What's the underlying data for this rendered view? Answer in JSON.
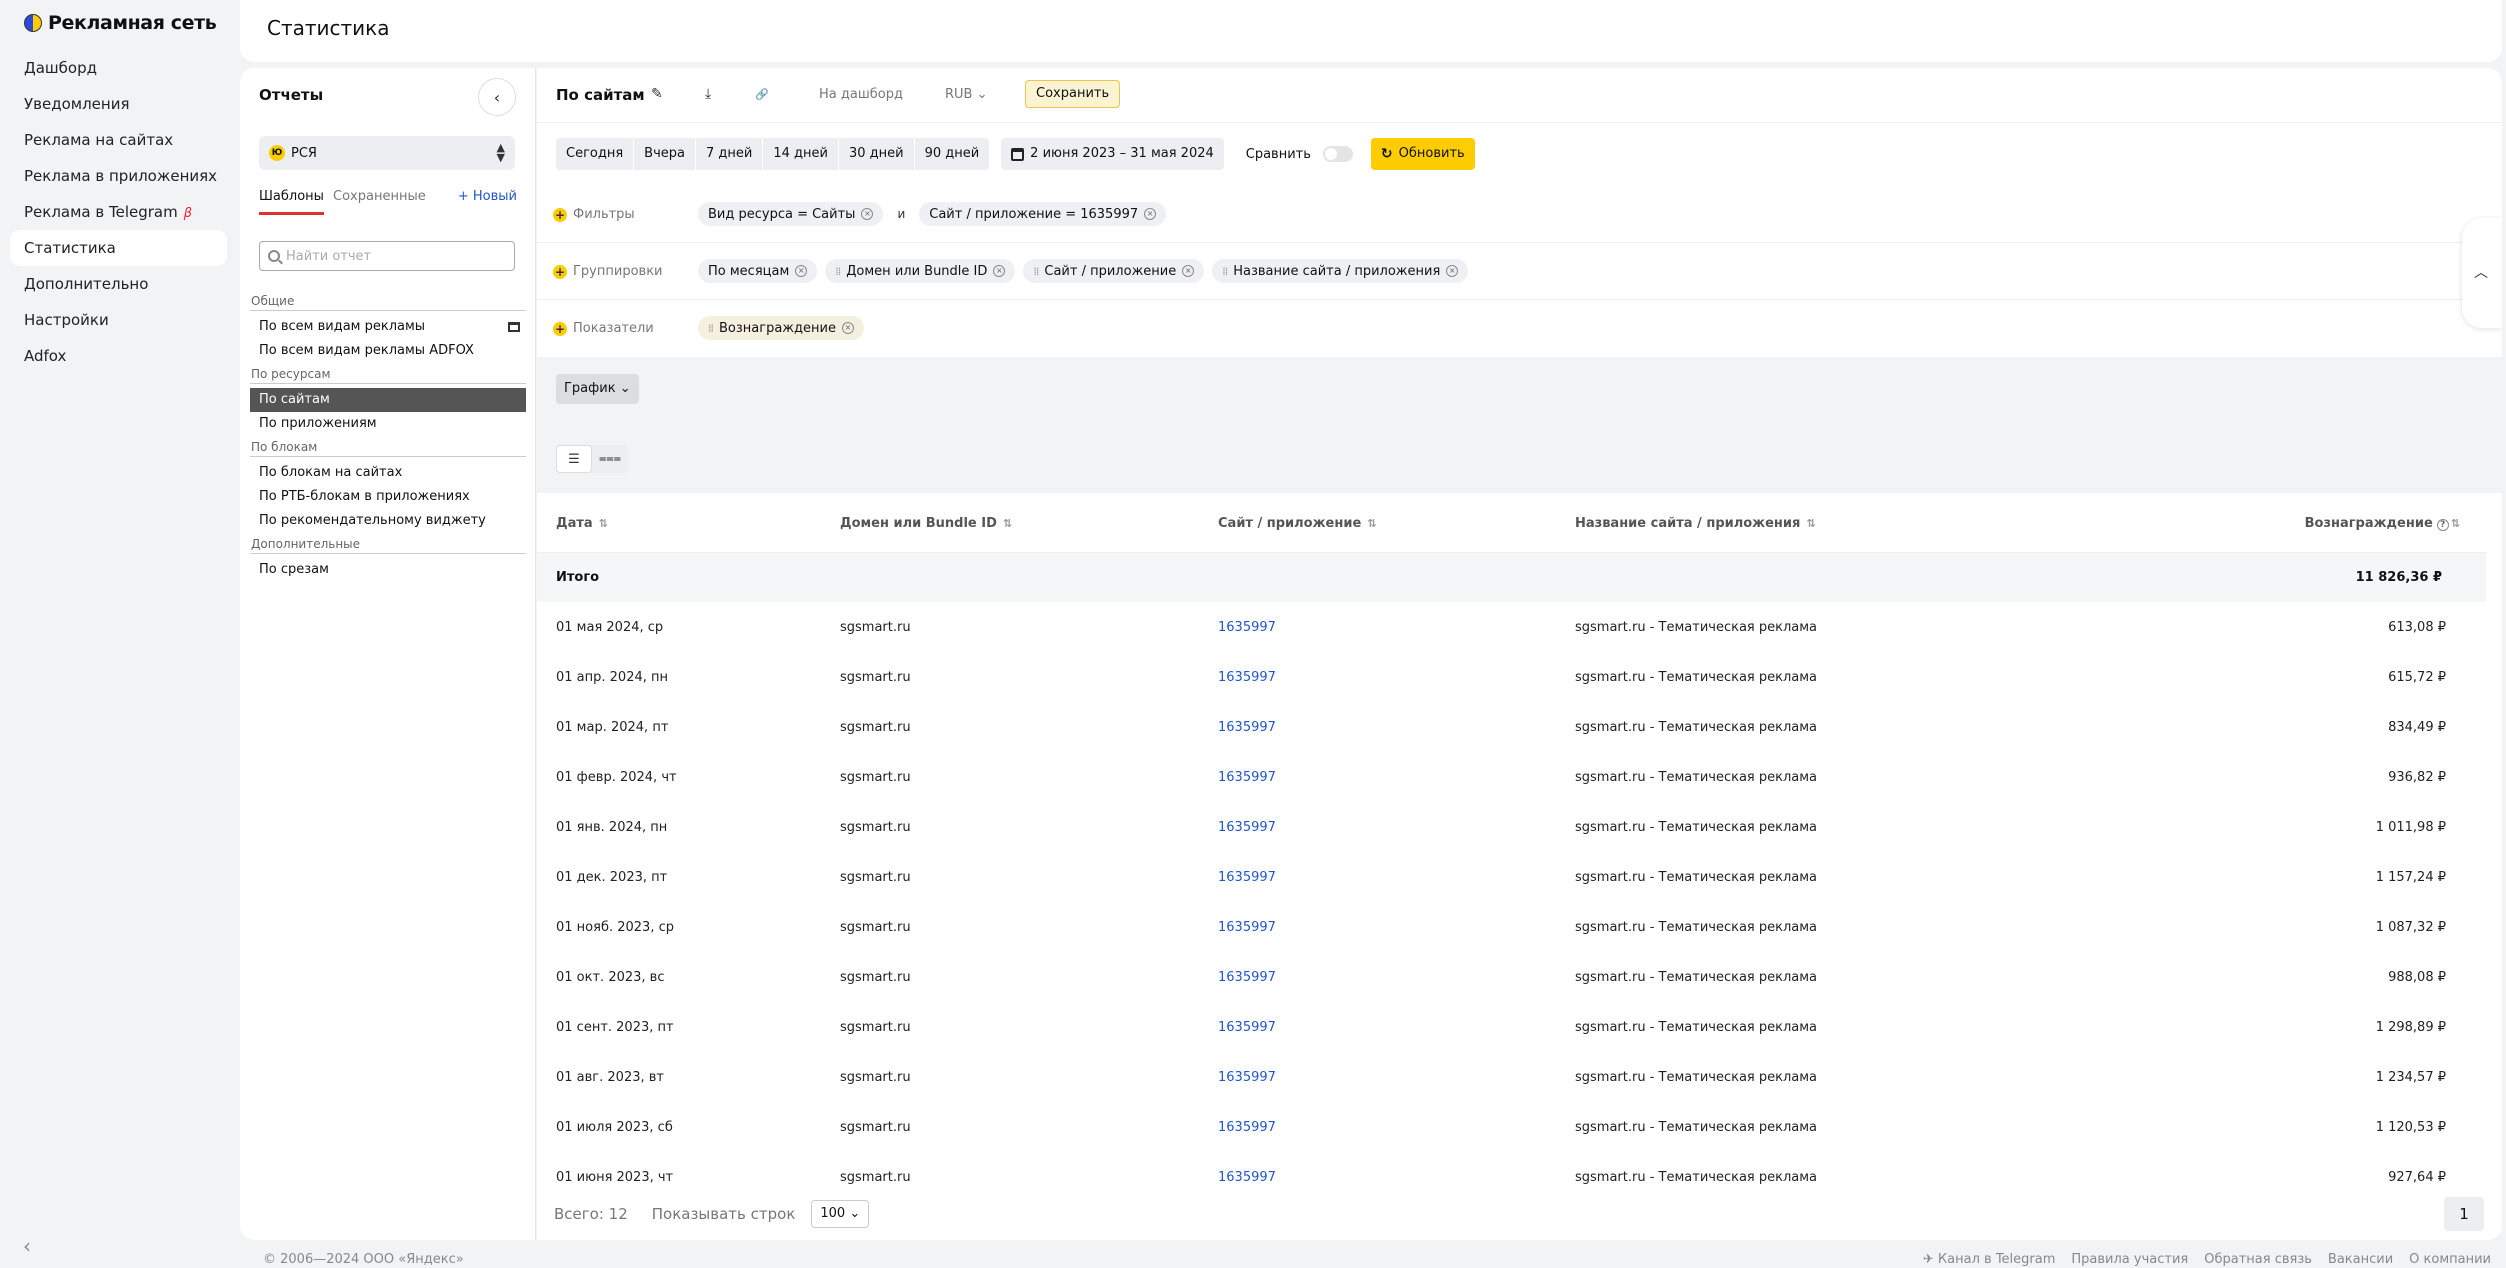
{
  "brand": {
    "name": "Рекламная сеть"
  },
  "nav": {
    "items": [
      {
        "label": "Дашборд"
      },
      {
        "label": "Уведомления"
      },
      {
        "label": "Реклама на сайтах"
      },
      {
        "label": "Реклама в приложениях"
      },
      {
        "label": "Реклама в Telegram",
        "badge": "β"
      },
      {
        "label": "Статистика",
        "active": true
      },
      {
        "label": "Дополнительно"
      },
      {
        "label": "Настройки"
      },
      {
        "label": "Adfox"
      }
    ],
    "collapse_icon": "‹"
  },
  "header": {
    "title": "Статистика"
  },
  "reports": {
    "title": "Отчеты",
    "collapse_icon": "‹",
    "account": {
      "coin": "Ю",
      "label": "РСЯ"
    },
    "tabs": [
      {
        "label": "Шаблоны",
        "active": true
      },
      {
        "label": "Сохраненные"
      }
    ],
    "new_label": "+ Новый",
    "search_placeholder": "Найти отчет",
    "groups": [
      {
        "title": "Общие",
        "items": [
          {
            "label": "По всем видам рекламы",
            "has_dashboard_icon": true
          },
          {
            "label": "По всем видам рекламы ADFOX"
          }
        ]
      },
      {
        "title": "По ресурсам",
        "items": [
          {
            "label": "По сайтам",
            "active": true
          },
          {
            "label": "По приложениям"
          }
        ]
      },
      {
        "title": "По блокам",
        "items": [
          {
            "label": "По блокам на сайтах"
          },
          {
            "label": "По РТБ-блокам в приложениях"
          },
          {
            "label": "По рекомендательному виджету"
          }
        ]
      },
      {
        "title": "Дополнительные",
        "items": [
          {
            "label": "По срезам"
          }
        ]
      }
    ]
  },
  "toolbar": {
    "title": "По сайтам",
    "edit_icon": "✎",
    "download_icon": "⤓",
    "link_icon": "🔗",
    "dashboard_label": "На дашборд",
    "currency": "RUB",
    "save_label": "Сохранить"
  },
  "period": {
    "presets": [
      "Сегодня",
      "Вчера",
      "7 дней",
      "14 дней",
      "30 дней",
      "90 дней"
    ],
    "range": "2 июня 2023 – 31 мая 2024",
    "compare_label": "Сравнить",
    "refresh_label": "Обновить"
  },
  "filters": {
    "label": "Фильтры",
    "chips": [
      "Вид ресурса = Сайты",
      "Сайт / приложение = 1635997"
    ],
    "connector": "и"
  },
  "groupings": {
    "label": "Группировки",
    "chips": [
      "По месяцам",
      "Домен или Bundle ID",
      "Сайт / приложение",
      "Название сайта / приложения"
    ]
  },
  "metrics": {
    "label": "Показатели",
    "chips": [
      "Вознаграждение"
    ]
  },
  "chart_button": "График",
  "table": {
    "columns": [
      "Дата",
      "Домен или Bundle ID",
      "Сайт / приложение",
      "Название сайта / приложения",
      "Вознаграждение"
    ],
    "total": {
      "label": "Итого",
      "value": "11 826,36 ₽"
    },
    "rows": [
      {
        "date": "01 мая 2024, ср",
        "domain": "sgsmart.ru",
        "site": "1635997",
        "name": "sgsmart.ru - Тематическая реклама",
        "reward": "613,08 ₽"
      },
      {
        "date": "01 апр. 2024, пн",
        "domain": "sgsmart.ru",
        "site": "1635997",
        "name": "sgsmart.ru - Тематическая реклама",
        "reward": "615,72 ₽"
      },
      {
        "date": "01 мар. 2024, пт",
        "domain": "sgsmart.ru",
        "site": "1635997",
        "name": "sgsmart.ru - Тематическая реклама",
        "reward": "834,49 ₽"
      },
      {
        "date": "01 февр. 2024, чт",
        "domain": "sgsmart.ru",
        "site": "1635997",
        "name": "sgsmart.ru - Тематическая реклама",
        "reward": "936,82 ₽"
      },
      {
        "date": "01 янв. 2024, пн",
        "domain": "sgsmart.ru",
        "site": "1635997",
        "name": "sgsmart.ru - Тематическая реклама",
        "reward": "1 011,98 ₽"
      },
      {
        "date": "01 дек. 2023, пт",
        "domain": "sgsmart.ru",
        "site": "1635997",
        "name": "sgsmart.ru - Тематическая реклама",
        "reward": "1 157,24 ₽"
      },
      {
        "date": "01 нояб. 2023, ср",
        "domain": "sgsmart.ru",
        "site": "1635997",
        "name": "sgsmart.ru - Тематическая реклама",
        "reward": "1 087,32 ₽"
      },
      {
        "date": "01 окт. 2023, вс",
        "domain": "sgsmart.ru",
        "site": "1635997",
        "name": "sgsmart.ru - Тематическая реклама",
        "reward": "988,08 ₽"
      },
      {
        "date": "01 сент. 2023, пт",
        "domain": "sgsmart.ru",
        "site": "1635997",
        "name": "sgsmart.ru - Тематическая реклама",
        "reward": "1 298,89 ₽"
      },
      {
        "date": "01 авг. 2023, вт",
        "domain": "sgsmart.ru",
        "site": "1635997",
        "name": "sgsmart.ru - Тематическая реклама",
        "reward": "1 234,57 ₽"
      },
      {
        "date": "01 июля 2023, сб",
        "domain": "sgsmart.ru",
        "site": "1635997",
        "name": "sgsmart.ru - Тематическая реклама",
        "reward": "1 120,53 ₽"
      },
      {
        "date": "01 июня 2023, чт",
        "domain": "sgsmart.ru",
        "site": "1635997",
        "name": "sgsmart.ru - Тематическая реклама",
        "reward": "927,64 ₽"
      }
    ]
  },
  "pager": {
    "total_label": "Всего: 12",
    "rows_label": "Показывать строк",
    "rows_value": "100",
    "page": "1"
  },
  "footer": {
    "copyright": "© 2006—2024 ООО «Яндекс»",
    "links": [
      "Канал в Telegram",
      "Правила участия",
      "Обратная связь",
      "Вакансии",
      "О компании"
    ]
  },
  "colors": {
    "accent": "#ffcc00",
    "link": "#2255cc",
    "beta": "#ee2233"
  }
}
